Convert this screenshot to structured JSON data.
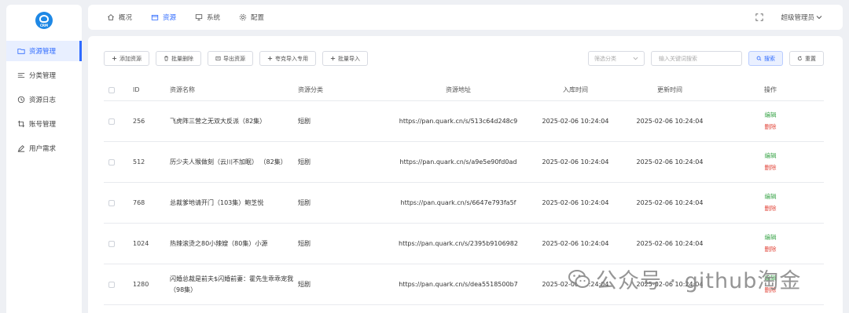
{
  "brand": {
    "logo_text": "CRM"
  },
  "sidebar": {
    "items": [
      {
        "label": "资源管理",
        "icon": "folder-icon",
        "active": true
      },
      {
        "label": "分类管理",
        "icon": "list-icon",
        "active": false
      },
      {
        "label": "资源日志",
        "icon": "clock-icon",
        "active": false
      },
      {
        "label": "账号管理",
        "icon": "crop-icon",
        "active": false
      },
      {
        "label": "用户需求",
        "icon": "pen-icon",
        "active": false
      }
    ]
  },
  "topbar": {
    "tabs": [
      {
        "label": "概况",
        "icon": "home-icon",
        "active": false
      },
      {
        "label": "资源",
        "icon": "box-icon",
        "active": true
      },
      {
        "label": "系统",
        "icon": "monitor-icon",
        "active": false
      },
      {
        "label": "配置",
        "icon": "gear-icon",
        "active": false
      }
    ],
    "fullscreen_icon": "fullscreen-icon",
    "user_label": "超级管理员"
  },
  "toolbar": {
    "add": "添加资源",
    "batch_delete": "批量删除",
    "export": "导出资源",
    "kuake_import": "夸克导入专用",
    "batch_import": "批量导入"
  },
  "filters": {
    "category_placeholder": "筛选分类",
    "keyword_placeholder": "输入关键词搜索",
    "search_label": "搜索",
    "reset_label": "重置"
  },
  "table": {
    "headers": {
      "id": "ID",
      "name": "资源名称",
      "category": "资源分类",
      "url": "资源地址",
      "created": "入库时间",
      "updated": "更新时间",
      "actions": "操作"
    },
    "rows": [
      {
        "id": "256",
        "name": "飞虎阵三营之无双大反派（82集）",
        "category": "短剧",
        "url": "https://pan.quark.cn/s/513c64d248c9",
        "created": "2025-02-06 10:24:04",
        "updated": "2025-02-06 10:24:04",
        "edit": "编辑",
        "delete": "删除"
      },
      {
        "id": "512",
        "name": "历少夫人猴做刻（云川不加眠） （82集）",
        "category": "短剧",
        "url": "https://pan.quark.cn/s/a9e5e90fd0ad",
        "created": "2025-02-06 10:24:04",
        "updated": "2025-02-06 10:24:04",
        "edit": "编辑",
        "delete": "删除"
      },
      {
        "id": "768",
        "name": "总裁爹地请开门（103集）鲍芝悦",
        "category": "短剧",
        "url": "https://pan.quark.cn/s/6647e793fa5f",
        "created": "2025-02-06 10:24:04",
        "updated": "2025-02-06 10:24:04",
        "edit": "编辑",
        "delete": "删除"
      },
      {
        "id": "1024",
        "name": "热辣滚烫之80小辣嫂（80集）小源",
        "category": "短剧",
        "url": "https://pan.quark.cn/s/2395b9106982",
        "created": "2025-02-06 10:24:04",
        "updated": "2025-02-06 10:24:04",
        "edit": "编辑",
        "delete": "删除"
      },
      {
        "id": "1280",
        "name": "闪婚总裁是前夫$闪婚前妻：霍先生乖乖宠我（98集）",
        "category": "短剧",
        "url": "https://pan.quark.cn/s/dea5518500b7",
        "created": "2025-02-06 10:24:04",
        "updated": "2025-02-06 10:24:04",
        "edit": "编辑",
        "delete": "删除"
      }
    ]
  },
  "watermark": {
    "text": "公众号 · github淘金",
    "icon": "wechat-icon"
  },
  "colors": {
    "accent": "#2f6bff",
    "edit": "#3ba54a",
    "delete": "#e2463a",
    "background": "#eef0f4"
  }
}
